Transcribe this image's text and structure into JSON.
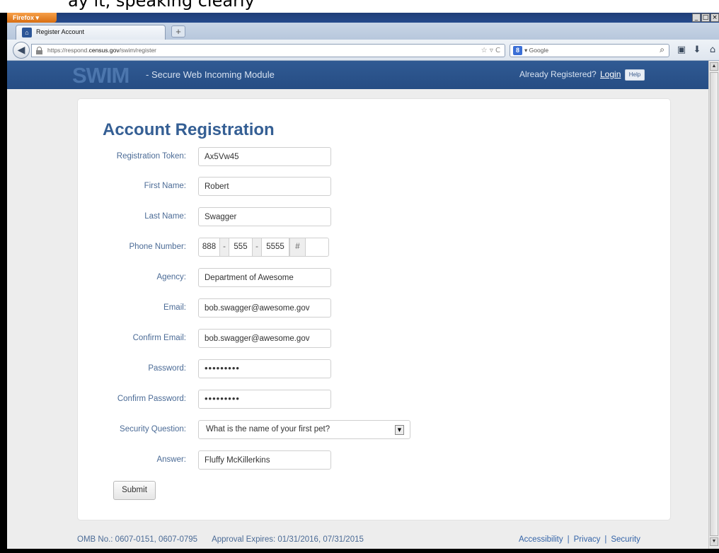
{
  "caption": "ay it, speaking clearly",
  "browser": {
    "menu_label": "Firefox ▾",
    "window_controls": [
      "_",
      "□",
      "×"
    ],
    "tab_title": "Register Account",
    "new_tab": "+",
    "url_prefix": "https://respond.",
    "url_domain": "census.gov",
    "url_path": "/swim/register",
    "url_icons": "☆ ▿ C",
    "search_engine": "Google",
    "icons": [
      "back-arrow-icon",
      "lock-icon",
      "star-icon",
      "reload-icon",
      "google-icon",
      "search-icon",
      "addon-icon",
      "download-icon",
      "home-icon"
    ]
  },
  "header": {
    "logo": "SWIM",
    "tagline": "- Secure Web Incoming Module",
    "already_registered": "Already Registered?",
    "login": "Login",
    "help": "Help",
    "background": "#2c5590"
  },
  "form": {
    "title": "Account Registration",
    "fields": {
      "token": {
        "label": "Registration Token:",
        "value": "Ax5Vw45"
      },
      "first_name": {
        "label": "First Name:",
        "value": "Robert"
      },
      "last_name": {
        "label": "Last Name:",
        "value": "Swagger"
      },
      "phone": {
        "label": "Phone Number:",
        "area": "888",
        "prefix": "555",
        "line": "5555",
        "ext_symbol": "#",
        "ext": "",
        "sep": "-"
      },
      "agency": {
        "label": "Agency:",
        "value": "Department of Awesome"
      },
      "email": {
        "label": "Email:",
        "value": "bob.swagger@awesome.gov"
      },
      "confirm_email": {
        "label": "Confirm Email:",
        "value": "bob.swagger@awesome.gov"
      },
      "password": {
        "label": "Password:",
        "value": "•••••••••"
      },
      "confirm_password": {
        "label": "Confirm Password:",
        "value": "•••••••••"
      },
      "security_question": {
        "label": "Security Question:",
        "value": "What is the name of your first pet?"
      },
      "answer": {
        "label": "Answer:",
        "value": "Fluffy McKillerkins"
      }
    },
    "submit": "Submit"
  },
  "footer": {
    "omb": "OMB No.: 0607-0151, 0607-0795",
    "approval": "Approval Expires: 01/31/2016, 07/31/2015",
    "links": [
      "Accessibility",
      "Privacy",
      "Security"
    ],
    "separator": "|"
  }
}
